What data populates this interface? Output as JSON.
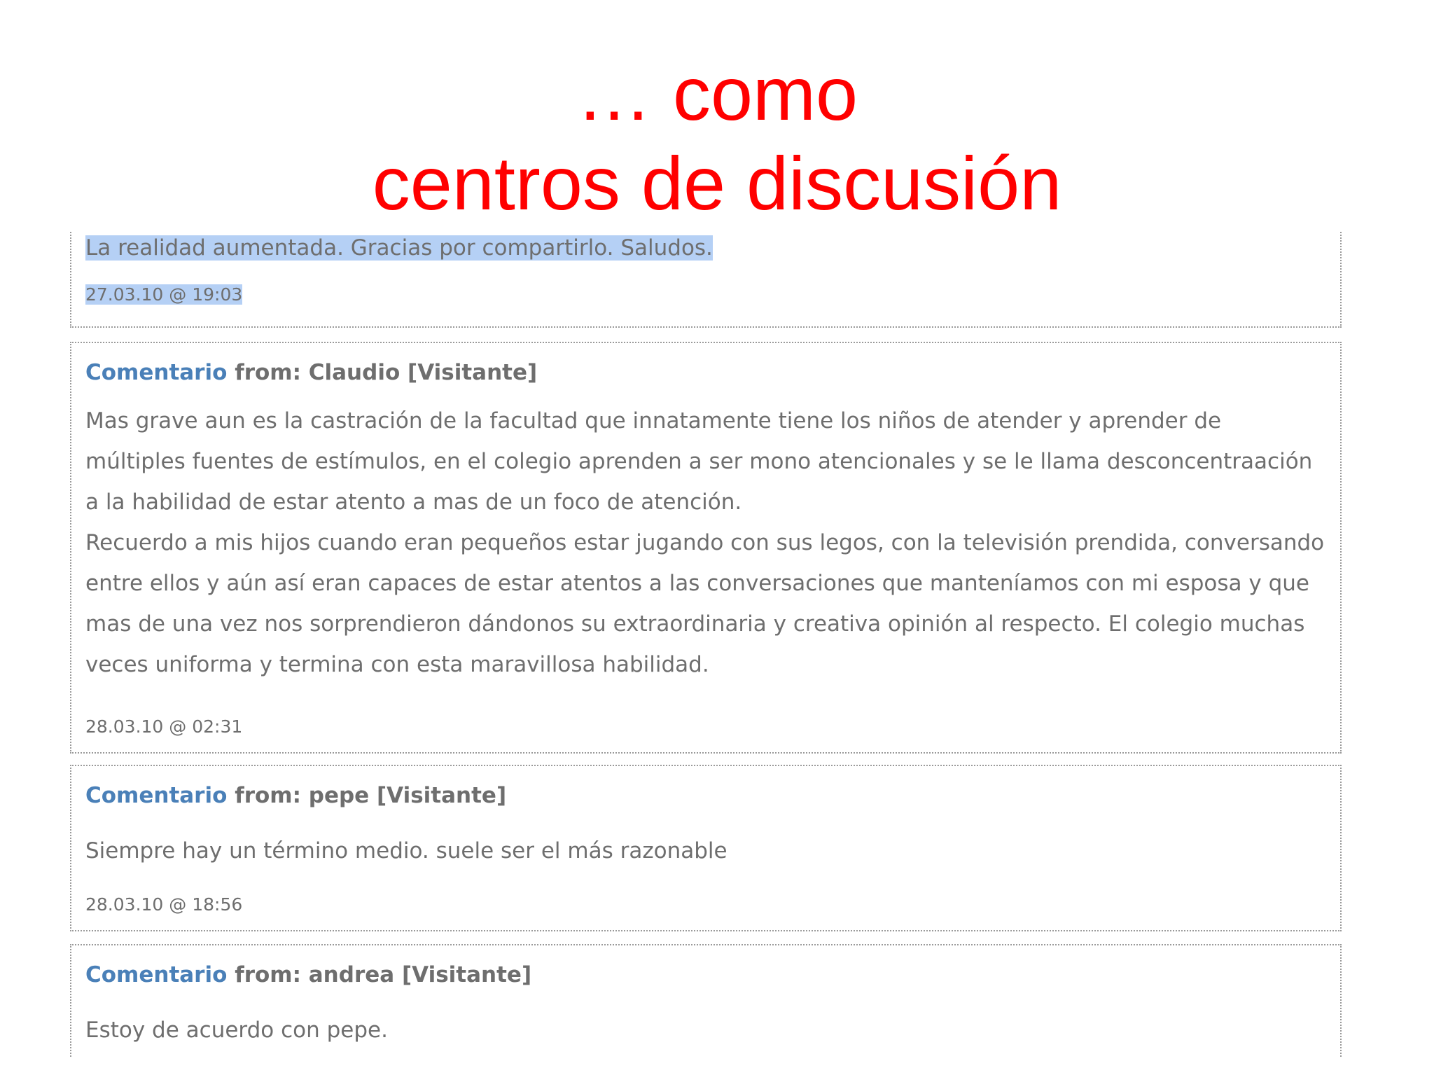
{
  "title": {
    "line1": "… como",
    "line2": "centros de discusión"
  },
  "comments": [
    {
      "body": [
        "La realidad aumentada. Gracias por compartirlo. Saludos."
      ],
      "timestamp": "27.03.10 @ 19:03",
      "selected": true
    },
    {
      "label": "Comentario",
      "from": "from: Claudio [Visitante]",
      "body": [
        "Mas grave aun es la castración de la facultad que innatamente tiene los niños de atender y aprender de múltiples fuentes de estímulos, en el colegio aprenden a ser mono atencionales y se le llama desconcentraación a la habilidad de estar atento a mas de un foco de atención.",
        "Recuerdo a mis hijos cuando eran pequeños estar jugando con sus legos, con la televisión prendida, conversando entre ellos y aún así eran capaces de estar atentos a las conversaciones que manteníamos con mi esposa y que mas de una vez nos sorprendieron dándonos su extraordinaria y creativa opinión al respecto. El colegio muchas veces uniforma y termina con esta maravillosa habilidad."
      ],
      "timestamp": "28.03.10 @ 02:31"
    },
    {
      "label": "Comentario",
      "from": "from: pepe [Visitante]",
      "body": [
        "Siempre hay un término medio. suele ser el más razonable"
      ],
      "timestamp": "28.03.10 @ 18:56"
    },
    {
      "label": "Comentario",
      "from": "from: andrea [Visitante]",
      "body": [
        "Estoy de acuerdo con pepe."
      ]
    }
  ],
  "colors": {
    "title": "#ff0000",
    "comment_label": "#4a80b8",
    "text": "#6e6e6e",
    "selection": "#b5d0f5"
  }
}
